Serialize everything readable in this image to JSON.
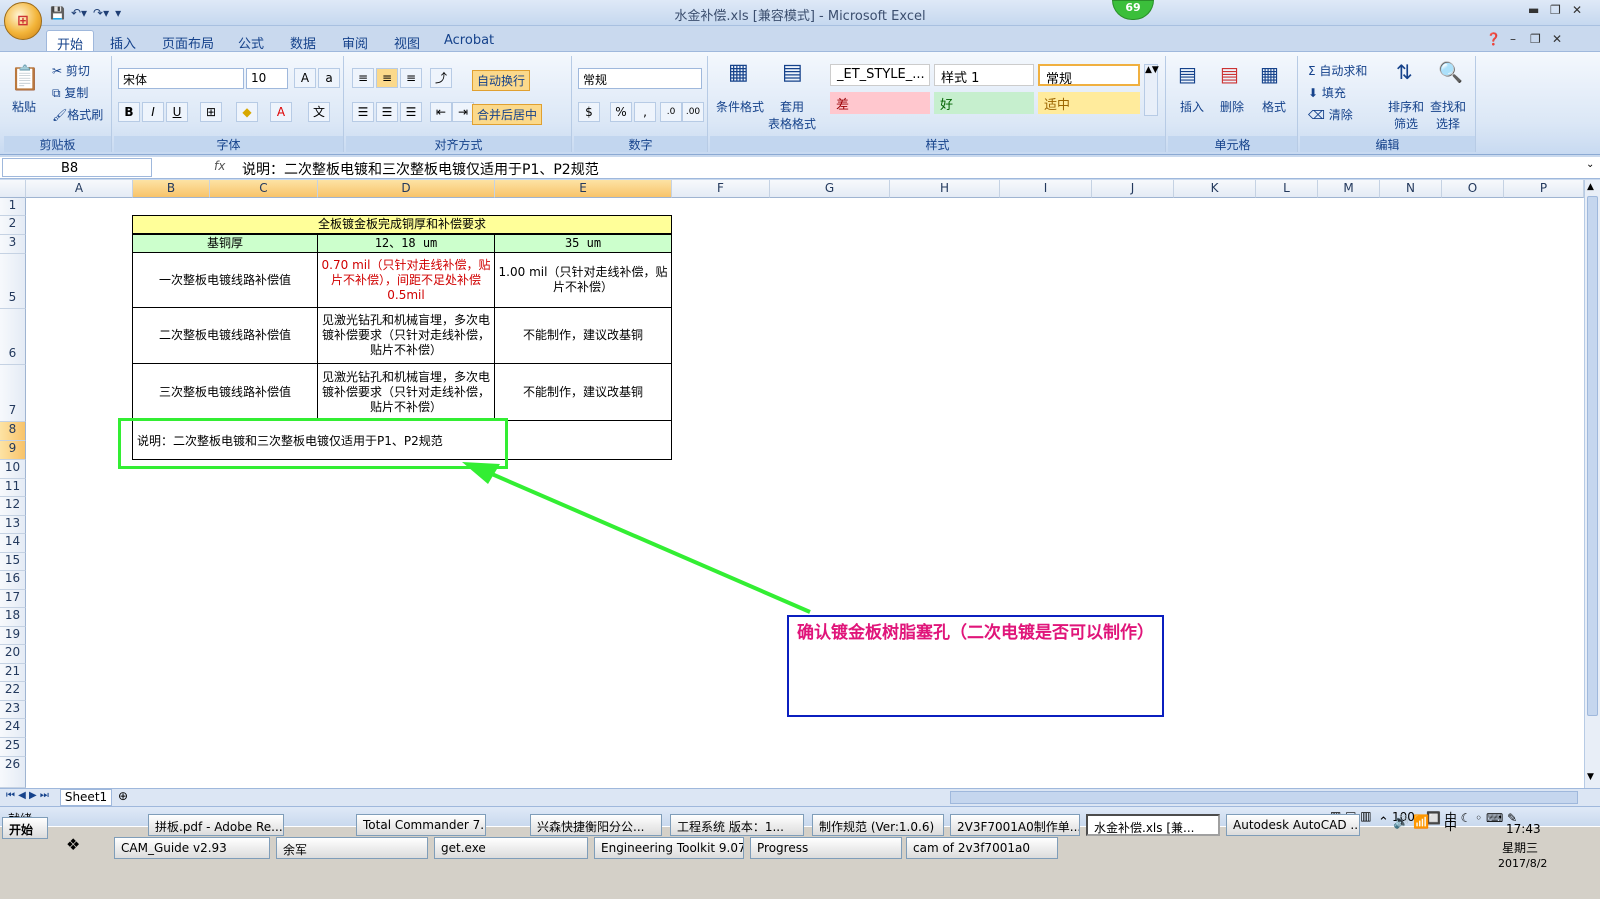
{
  "window": {
    "title": "水金补偿.xls  [兼容模式] - Microsoft Excel",
    "badge": "69"
  },
  "tabs": [
    "开始",
    "插入",
    "页面布局",
    "公式",
    "数据",
    "审阅",
    "视图",
    "Acrobat"
  ],
  "ribbon": {
    "clipboard": {
      "paste": "粘贴",
      "cut": "剪切",
      "copy": "复制",
      "format_painter": "格式刷",
      "label": "剪贴板"
    },
    "font": {
      "name": "宋体",
      "size": "10",
      "label": "字体"
    },
    "alignment": {
      "wrap": "自动换行",
      "merge": "合并后居中",
      "label": "对齐方式"
    },
    "number": {
      "format": "常规",
      "label": "数字"
    },
    "styles": {
      "cond_format": "条件格式",
      "table_format": "套用\n表格格式",
      "cells": [
        "_ET_STYLE_...",
        "样式 1",
        "常规",
        "差",
        "好",
        "适中"
      ],
      "label": "样式"
    },
    "cells": {
      "insert": "插入",
      "delete": "删除",
      "format": "格式",
      "label": "单元格"
    },
    "editing": {
      "autosum": "自动求和",
      "fill": "填充",
      "clear": "清除",
      "sort": "排序和\n筛选",
      "find": "查找和\n选择",
      "label": "编辑"
    }
  },
  "formula_bar": {
    "name_box": "B8",
    "fx": "fx",
    "content": "说明：二次整板电镀和三次整板电镀仅适用于P1、P2规范"
  },
  "columns": [
    "A",
    "B",
    "C",
    "D",
    "E",
    "F",
    "G",
    "H",
    "I",
    "J",
    "K",
    "L",
    "M",
    "N",
    "O",
    "P"
  ],
  "rows": [
    "1",
    "2",
    "3",
    "5",
    "6",
    "7",
    "8",
    "9",
    "10",
    "11",
    "12",
    "13",
    "14",
    "15",
    "16",
    "17",
    "18",
    "19",
    "20",
    "21",
    "22",
    "23",
    "24",
    "25",
    "26"
  ],
  "table": {
    "title": "全板镀金板完成铜厚和补偿要求",
    "header": [
      "基铜厚",
      "12、18 um",
      "35 um"
    ],
    "rows": [
      {
        "label": "一次整板电镀线路补偿值",
        "c1": "0.70 mil（只针对走线补偿，贴片不补偿），间距不足处补偿0.5mil",
        "c2": "1.00 mil（只针对走线补偿，贴片不补偿）"
      },
      {
        "label": "二次整板电镀线路补偿值",
        "c1": "见激光钻孔和机械盲埋，多次电镀补偿要求（只针对走线补偿，贴片不补偿）",
        "c2": "不能制作，建议改基铜"
      },
      {
        "label": "三次整板电镀线路补偿值",
        "c1": "见激光钻孔和机械盲埋，多次电镀补偿要求（只针对走线补偿，贴片不补偿）",
        "c2": "不能制作，建议改基铜"
      }
    ],
    "note": "说明：二次整板电镀和三次整板电镀仅适用于P1、P2规范"
  },
  "annotation": {
    "text": "确认镀金板树脂塞孔（二次电镀是否可以制作）",
    "colors": {
      "arrow": "#33ee33",
      "box": "#0b1fbf",
      "text": "#e0157a"
    }
  },
  "sheet_tab": "Sheet1",
  "status": {
    "ready": "就绪",
    "zoom": "100"
  },
  "taskbar": {
    "start": "开始",
    "row1": [
      "拼板.pdf - Adobe Re...",
      "Total Commander 7....",
      "兴森快捷衡阳分公...",
      "工程系统  版本：1...",
      "制作规范 (Ver:1.0.6)",
      "2V3F7001A0制作单...",
      "水金补偿.xls [兼...",
      "Autodesk AutoCAD ..."
    ],
    "row2": [
      "CAM_Guide v2.93",
      "余军",
      "get.exe",
      "Engineering Toolkit 9.07...",
      "Progress",
      "cam of 2v3f7001a0"
    ],
    "time": "17:43",
    "weekday": "星期三",
    "date": "2017/8/2",
    "ime": "中"
  }
}
